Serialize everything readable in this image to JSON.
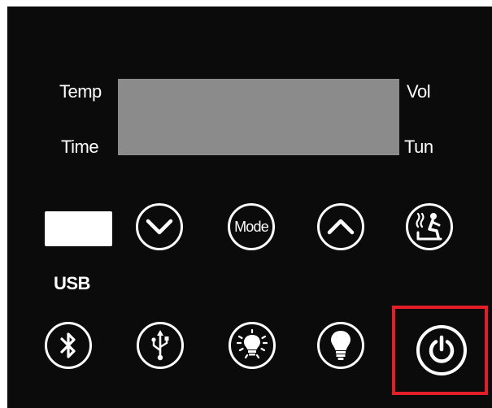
{
  "labels": {
    "temp": "Temp",
    "time": "Time",
    "vol": "Vol",
    "tun": "Tun",
    "usb": "USB"
  },
  "buttons": {
    "mode": "Mode"
  },
  "icons": {
    "row1": [
      "chevron-down-icon",
      "mode-button",
      "chevron-up-icon",
      "sauna-person-icon"
    ],
    "row2": [
      "bluetooth-icon",
      "usb-icon",
      "light-bulb-rays-icon",
      "light-bulb-icon",
      "power-icon"
    ]
  },
  "colors": {
    "panel": "#0b0b0b",
    "display": "#8b8b8b",
    "button_outline": "#ffffff",
    "highlight": "#e41e26",
    "header_text": "#f47b20"
  }
}
